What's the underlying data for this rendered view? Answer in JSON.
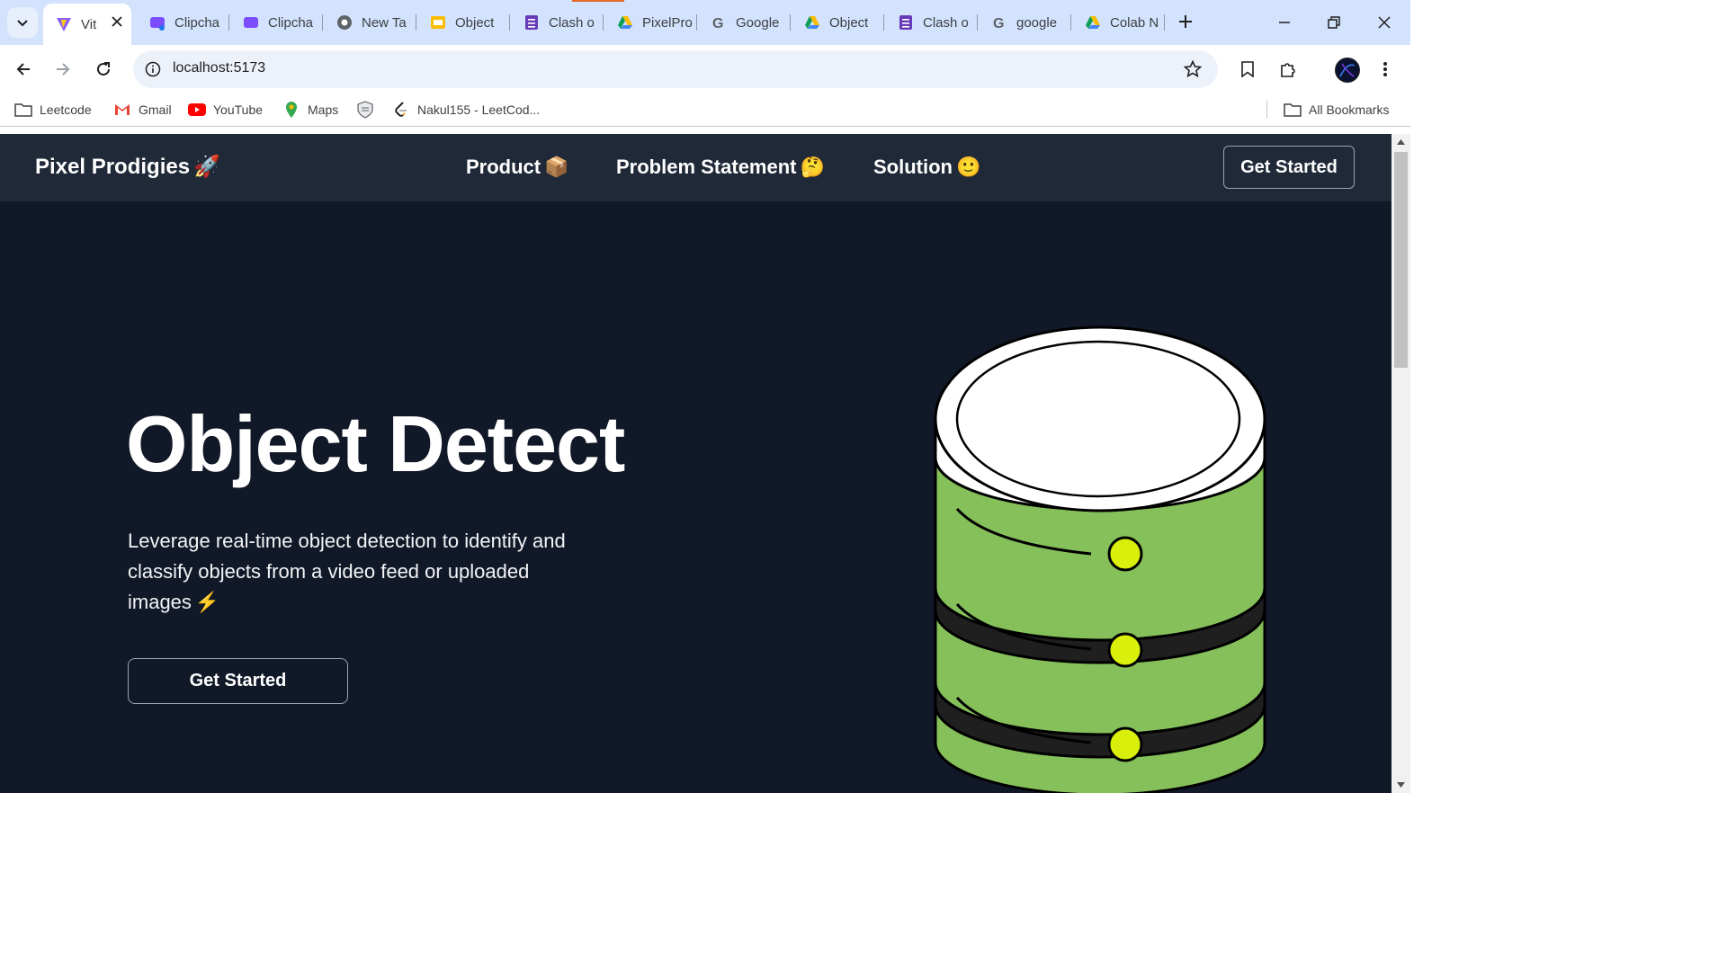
{
  "browser": {
    "tabs": [
      {
        "title": "Vit",
        "icon": "vite-icon",
        "active": true
      },
      {
        "title": "Clipcha",
        "icon": "clipchamp-icon"
      },
      {
        "title": "Clipcha",
        "icon": "clipchamp-icon"
      },
      {
        "title": "New Ta",
        "icon": "chrome-icon"
      },
      {
        "title": "Object",
        "icon": "slides-icon"
      },
      {
        "title": "Clash o",
        "icon": "forms-icon"
      },
      {
        "title": "PixelPro",
        "icon": "drive-icon"
      },
      {
        "title": "Google",
        "icon": "google-icon"
      },
      {
        "title": "Object",
        "icon": "drive-icon"
      },
      {
        "title": "Clash o",
        "icon": "forms-icon"
      },
      {
        "title": "google",
        "icon": "google-icon"
      },
      {
        "title": "Colab N",
        "icon": "drive-icon"
      }
    ],
    "url": "localhost:5173",
    "bookmarks": [
      {
        "label": "Leetcode",
        "icon": "folder-icon"
      },
      {
        "label": "Gmail",
        "icon": "gmail-icon"
      },
      {
        "label": "YouTube",
        "icon": "youtube-icon"
      },
      {
        "label": "Maps",
        "icon": "maps-icon"
      },
      {
        "label": "",
        "icon": "shield-crest-icon"
      },
      {
        "label": "Nakul155 - LeetCod...",
        "icon": "leetcode-icon"
      }
    ],
    "all_bookmarks_label": "All Bookmarks"
  },
  "site": {
    "brand": "Pixel Prodigies",
    "brand_emoji": "🚀",
    "nav": [
      {
        "label": "Product",
        "emoji": "📦"
      },
      {
        "label": "Problem Statement",
        "emoji": "🤔"
      },
      {
        "label": "Solution",
        "emoji": "🙂"
      }
    ],
    "nav_cta": "Get Started",
    "hero": {
      "title": "Object Detect",
      "description": "Leverage real-time object detection to identify and classify objects from a video feed or uploaded images",
      "description_emoji": "⚡",
      "cta": "Get Started"
    }
  },
  "colors": {
    "page_bg": "#111827",
    "navbar_bg": "#1f2937",
    "db_green": "#86c05a",
    "db_light": "#d9ef0c"
  }
}
